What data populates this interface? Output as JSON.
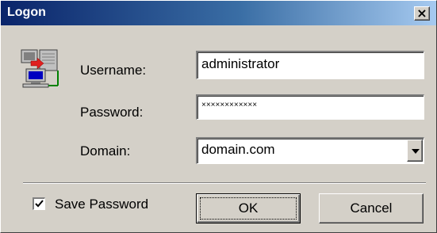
{
  "window": {
    "title": "Logon",
    "close_symbol": "×",
    "icon": "network-computers-icon"
  },
  "form": {
    "username_label": "Username:",
    "username_value": "administrator",
    "password_label": "Password:",
    "password_value": "××××××××××××",
    "domain_label": "Domain:",
    "domain_value": "domain.com"
  },
  "footer": {
    "save_password_label": "Save Password",
    "save_password_checked": true,
    "ok_label": "OK",
    "cancel_label": "Cancel"
  },
  "colors": {
    "titlebar_start": "#0a246a",
    "titlebar_end": "#a6caf0",
    "dialog_face": "#d4d0c8"
  }
}
